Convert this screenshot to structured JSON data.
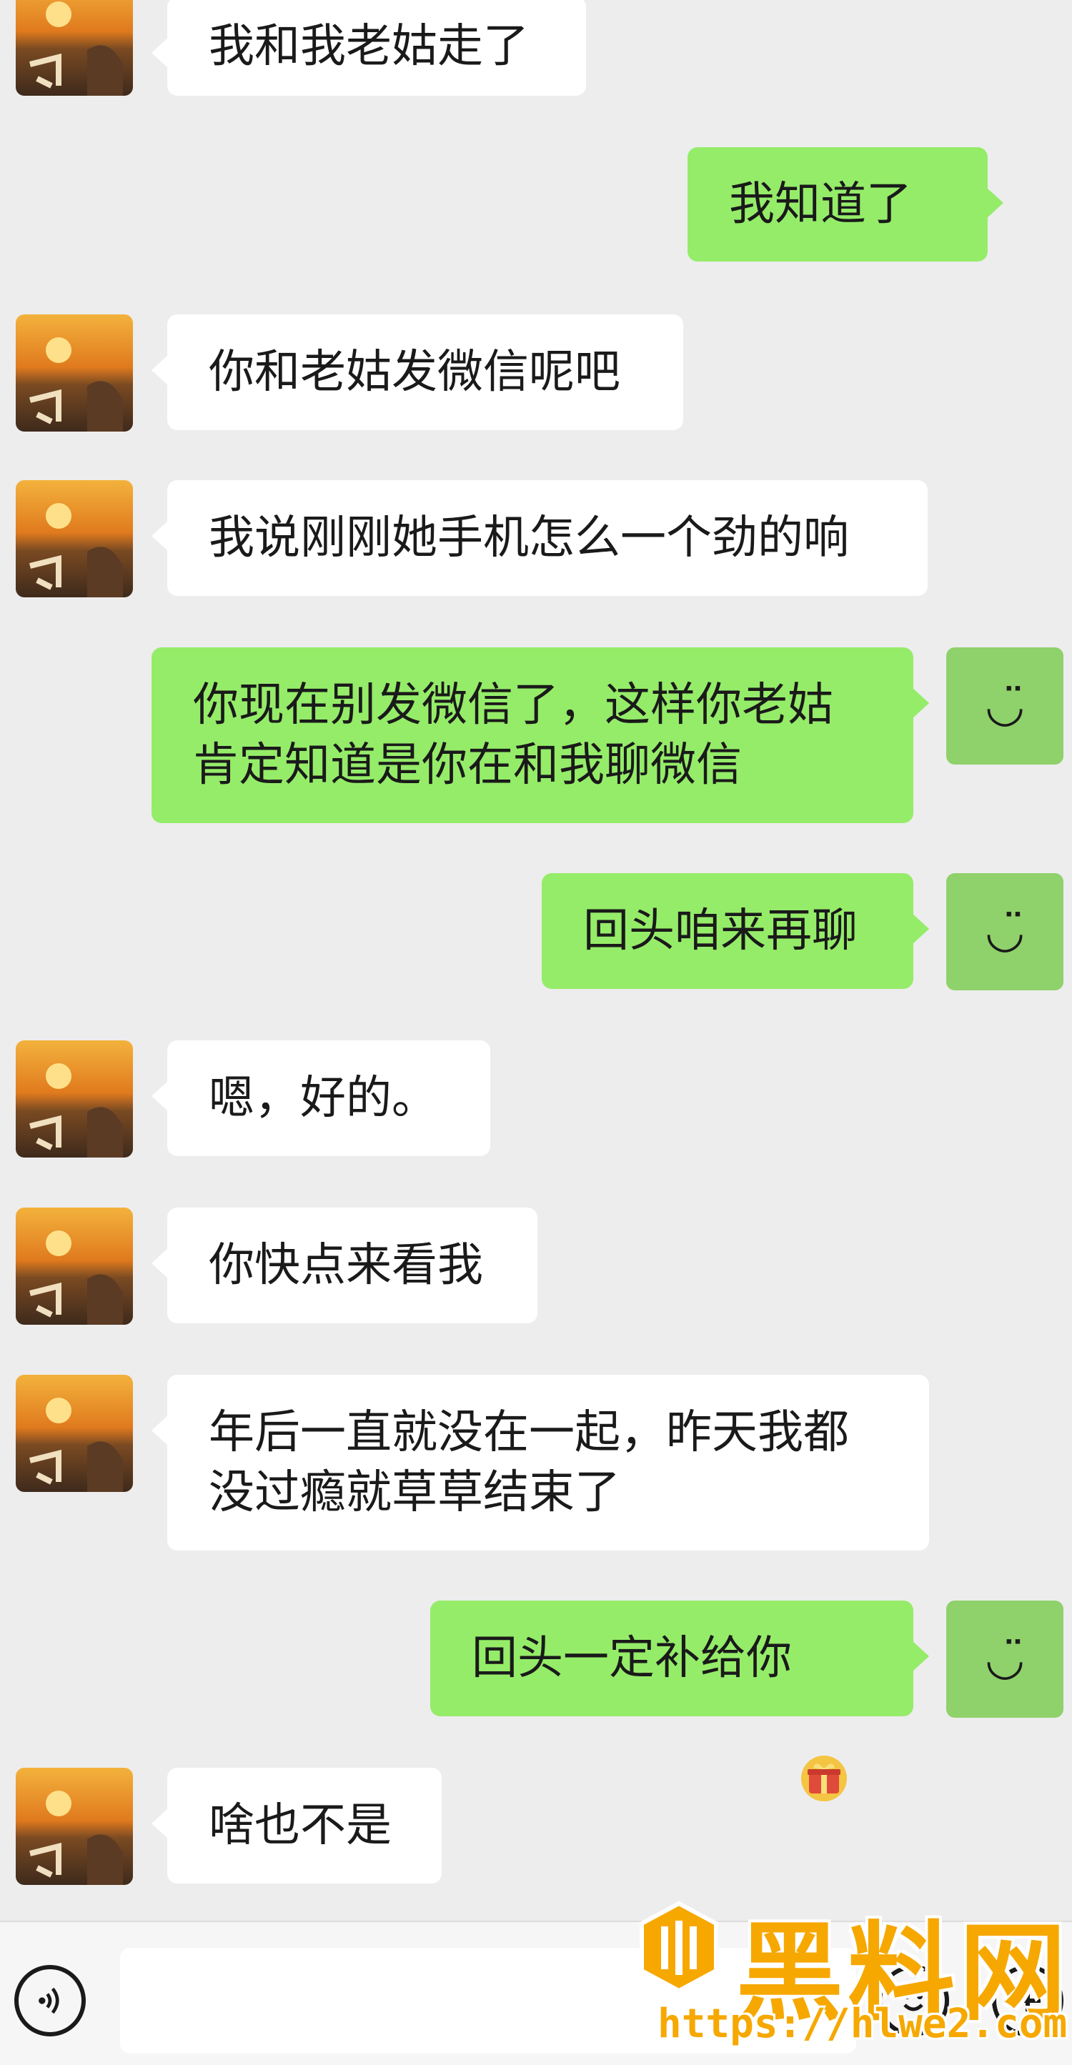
{
  "messages": [
    {
      "side": "in",
      "text": "我和我老姑走了"
    },
    {
      "side": "out",
      "text": "我知道了"
    },
    {
      "side": "in",
      "text": "你和老姑发微信呢吧"
    },
    {
      "side": "in",
      "text": "我说刚刚她手机怎么一个劲的响"
    },
    {
      "side": "out",
      "text": "你现在别发微信了，这样你老姑\n肯定知道是你在和我聊微信"
    },
    {
      "side": "out",
      "text": "回头咱来再聊"
    },
    {
      "side": "in",
      "text": "嗯，好的。"
    },
    {
      "side": "in",
      "text": "你快点来看我"
    },
    {
      "side": "in",
      "text": "年后一直就没在一起，昨天我都\n没过瘾就草草结束了"
    },
    {
      "side": "out",
      "text": "回头一定补给你"
    },
    {
      "side": "in",
      "text": "啥也不是"
    }
  ],
  "self_avatar_face": "◡̈",
  "icons": {
    "voice": "voice-icon",
    "emoji": "emoji-icon",
    "plus": "plus-icon",
    "gift": "gift-emoji-icon"
  },
  "input": {
    "value": "",
    "placeholder": ""
  },
  "watermark": {
    "title": "黑料网",
    "url": "https://hlwe2.com"
  },
  "colors": {
    "background": "#ededed",
    "incoming": "#ffffff",
    "outgoing": "#95ec69",
    "watermark": "#f6a800"
  }
}
